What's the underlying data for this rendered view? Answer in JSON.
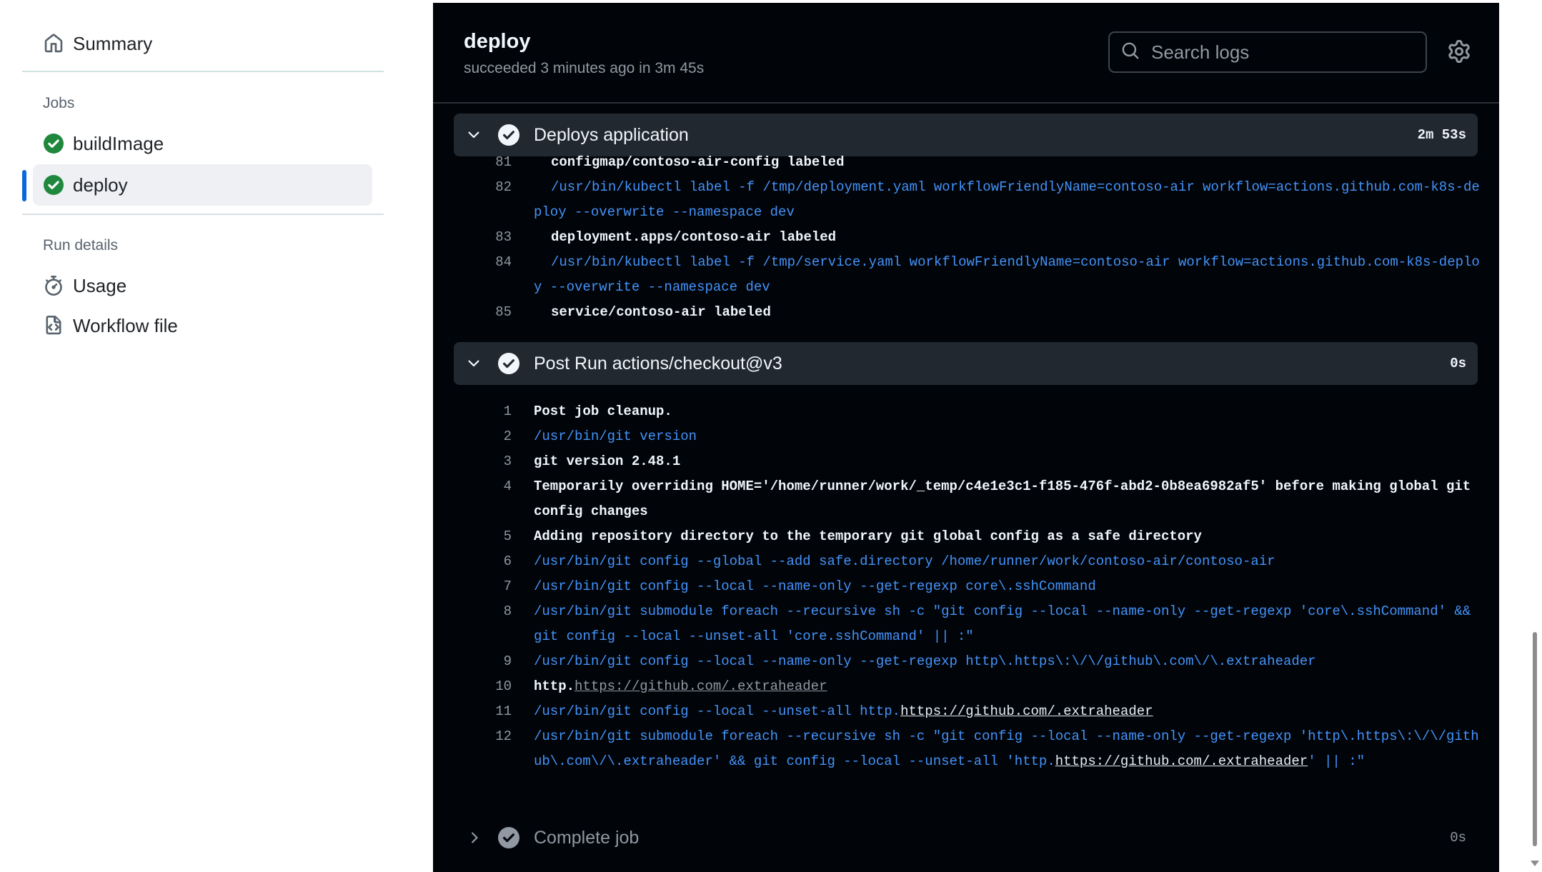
{
  "sidebar": {
    "summary_label": "Summary",
    "jobs_heading": "Jobs",
    "jobs": [
      {
        "label": "buildImage",
        "status": "success"
      },
      {
        "label": "deploy",
        "status": "success"
      }
    ],
    "run_details_heading": "Run details",
    "usage_label": "Usage",
    "workflow_file_label": "Workflow file"
  },
  "job": {
    "title": "deploy",
    "status_text": "succeeded 3 minutes ago in 3m 45s"
  },
  "search": {
    "placeholder": "Search logs"
  },
  "colors": {
    "success_green": "#1f883d",
    "active_bar": "#0969da",
    "log_bg": "#010409",
    "command_blue": "#4493f8"
  },
  "steps": [
    {
      "name": "Deploys application",
      "duration": "2m 53s",
      "expanded": true,
      "lines": [
        {
          "num": "81",
          "text": "configmap/contoso-air-config labeled"
        },
        {
          "num": "82",
          "text": "/usr/bin/kubectl label -f /tmp/deployment.yaml workflowFriendlyName=contoso-air workflow=actions.github.com-k8s-deploy --overwrite --namespace dev"
        },
        {
          "num": "83",
          "text": "deployment.apps/contoso-air labeled"
        },
        {
          "num": "84",
          "text": "/usr/bin/kubectl label -f /tmp/service.yaml workflowFriendlyName=contoso-air workflow=actions.github.com-k8s-deploy --overwrite --namespace dev"
        },
        {
          "num": "85",
          "text": "service/contoso-air labeled"
        }
      ]
    },
    {
      "name": "Post Run actions/checkout@v3",
      "duration": "0s",
      "expanded": true,
      "lines": [
        {
          "num": "1",
          "text": "Post job cleanup."
        },
        {
          "num": "2",
          "text": "/usr/bin/git version"
        },
        {
          "num": "3",
          "text": "git version 2.48.1"
        },
        {
          "num": "4",
          "text": "Temporarily overriding HOME='/home/runner/work/_temp/c4e1e3c1-f185-476f-abd2-0b8ea6982af5' before making global git config changes"
        },
        {
          "num": "5",
          "text": "Adding repository directory to the temporary git global config as a safe directory"
        },
        {
          "num": "6",
          "text": "/usr/bin/git config --global --add safe.directory /home/runner/work/contoso-air/contoso-air"
        },
        {
          "num": "7",
          "text": "/usr/bin/git config --local --name-only --get-regexp core\\.sshCommand"
        },
        {
          "num": "8",
          "text": "/usr/bin/git submodule foreach --recursive sh -c \"git config --local --name-only --get-regexp 'core\\.sshCommand' && git config --local --unset-all 'core.sshCommand' || :\""
        },
        {
          "num": "9",
          "text": "/usr/bin/git config --local --name-only --get-regexp http\\.https\\:\\/\\/github\\.com\\/\\.extraheader"
        },
        {
          "num": "10",
          "text_prefix": "http.",
          "link": "https://github.com/.extraheader"
        },
        {
          "num": "11",
          "text_prefix": "/usr/bin/git config --local --unset-all http.",
          "link": "https://github.com/.extraheader"
        },
        {
          "num": "12",
          "text_prefix": "/usr/bin/git submodule foreach --recursive sh -c \"git config --local --name-only --get-regexp 'http\\.https\\:\\/\\/github\\.com\\/\\.extraheader' && git config --local --unset-all 'http.",
          "link": "https://github.com/.extraheader",
          "text_suffix": "' || :\""
        }
      ]
    },
    {
      "name": "Complete job",
      "duration": "0s",
      "expanded": false
    }
  ]
}
